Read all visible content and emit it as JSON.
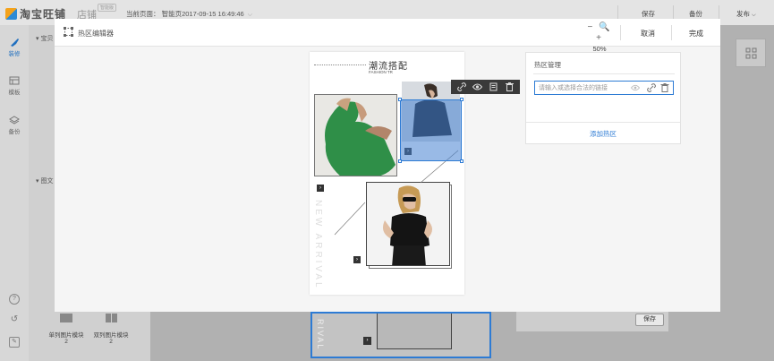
{
  "app": {
    "logo_text": "淘宝旺铺",
    "shop_name": "店铺",
    "shop_badge": "智能版",
    "current_page": "当前页面：  智能页2017-09-15 16:49:46",
    "actions": {
      "save": "保存",
      "backup": "备份",
      "publish": "发布"
    }
  },
  "leftnav": {
    "items": [
      {
        "label": "装修",
        "icon": "brush-icon",
        "active": true
      },
      {
        "label": "模板",
        "icon": "template-icon",
        "active": false
      },
      {
        "label": "备份",
        "icon": "layers-icon",
        "active": false
      }
    ],
    "bottom_icons": [
      "help-icon",
      "refresh-icon",
      "edit-icon"
    ]
  },
  "module_panel": {
    "sections": [
      "宝贝",
      "图文"
    ],
    "modules": [
      {
        "label": "单列图片模块",
        "count": "2"
      },
      {
        "label": "双列图片模块",
        "count": "2"
      }
    ]
  },
  "background": {
    "preview_text": "RIVAL",
    "save_button": "保存"
  },
  "modal": {
    "title": "热区编辑器",
    "zoom_controls": "− 🔍 +",
    "zoom_value": "50%",
    "cancel": "取消",
    "done": "完成"
  },
  "canvas": {
    "title": "潮流搭配",
    "subtitle": "FASHION TR",
    "vertical_text": "NEW ARRIVAL",
    "arrow": "›"
  },
  "hotspot_manager": {
    "title": "热区管理",
    "link_placeholder": "请输入或选择合法的链接",
    "add_hotspot": "添加热区"
  },
  "colors": {
    "accent": "#2d7bd4",
    "hotspot_fill": "#4682d2"
  }
}
